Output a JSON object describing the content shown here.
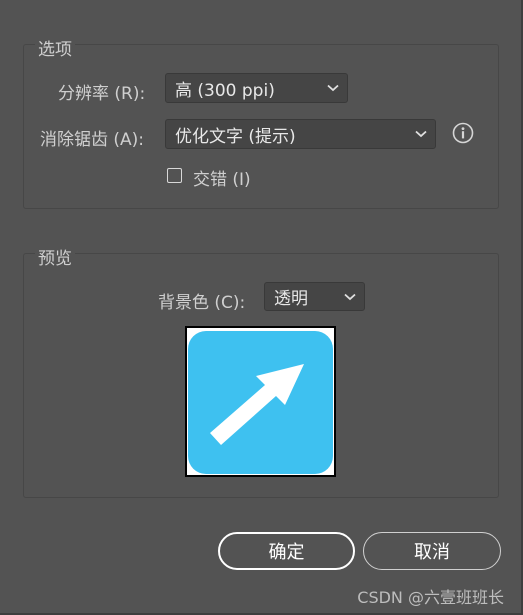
{
  "options": {
    "group_label": "选项",
    "resolution_label": "分辨率 (R):",
    "resolution_value": "高 (300 ppi)",
    "antialias_label": "消除锯齿 (A):",
    "antialias_value": "优化文字 (提示)",
    "interlace_label": "交错 (I)",
    "interlace_checked": false
  },
  "preview": {
    "group_label": "预览",
    "background_label": "背景色 (C):",
    "background_value": "透明",
    "image_color": "#3ec1f0",
    "arrow_color": "#ffffff"
  },
  "actions": {
    "ok_label": "确定",
    "cancel_label": "取消"
  },
  "watermark": "CSDN @六壹班班长"
}
